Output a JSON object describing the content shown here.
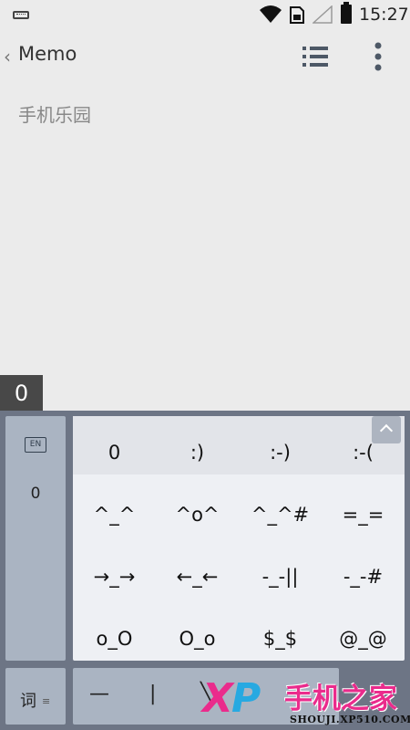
{
  "status_bar": {
    "time": "15:27"
  },
  "header": {
    "back_chevron": "‹",
    "title": "Memo"
  },
  "memo": {
    "text": "手机乐园"
  },
  "candidate": {
    "text": "0"
  },
  "keyboard": {
    "lang_badge": "EN",
    "left_items": [
      "0"
    ],
    "emoticons": [
      [
        "0",
        ":)",
        ":-)",
        ":-("
      ],
      [
        "^_^",
        "^o^",
        "^_^#",
        "=_="
      ],
      [
        "→_→",
        "←_←",
        "-_-||",
        "-_-#"
      ],
      [
        "o_O",
        "O_o",
        "$_$",
        "@_@"
      ]
    ],
    "bottom_left_label": "词",
    "bottom_left_sub": "≡",
    "bottom_bar_symbols": [
      "—",
      "|",
      "╲"
    ]
  },
  "watermark": {
    "logo_x": "X",
    "logo_p": "P",
    "cn": "手机之家",
    "url": "SHOUJI.XP510.COM"
  }
}
